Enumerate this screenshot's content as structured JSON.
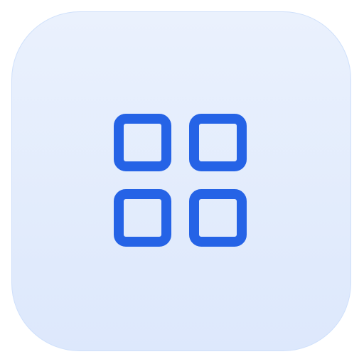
{
  "app_icon": {
    "icon": "grid-icon",
    "colors": {
      "tile_top": "#eaf1fd",
      "tile_bottom": "#dde8fc",
      "tile_border": "#cfe0fb",
      "icon_stroke": "#2563e6"
    }
  }
}
